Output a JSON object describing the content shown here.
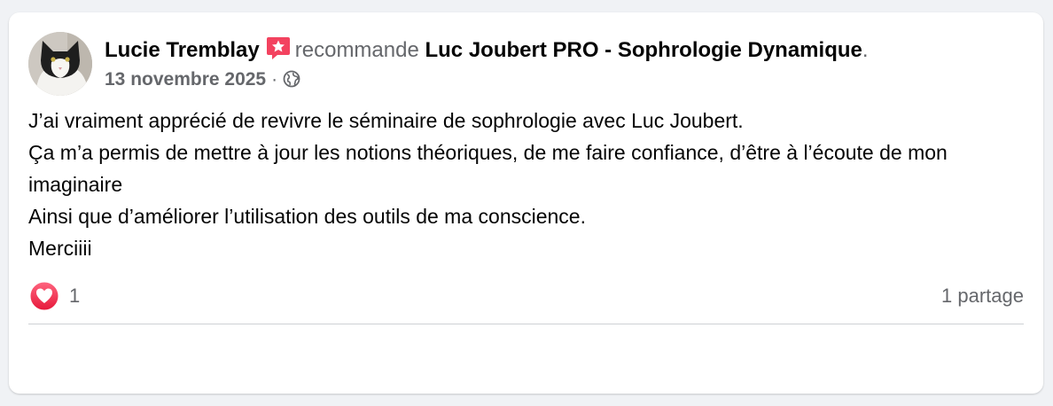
{
  "post": {
    "author": "Lucie Tremblay",
    "action": "recommande",
    "page_name": "Luc Joubert PRO - Sophrologie Dynamique",
    "period": ".",
    "date": "13 novembre 2025",
    "separator": "·",
    "privacy_icon": "globe-icon",
    "recommend_icon": "recommend-star-icon",
    "body_lines": [
      "J’ai vraiment apprécié de revivre le séminaire de sophrologie avec Luc Joubert.",
      "Ça m’a permis de mettre à jour les notions théoriques, de me faire confiance, d’être à l’écoute de mon imaginaire",
      "Ainsi que d’améliorer l’utilisation des outils de ma conscience.",
      "Merciiii"
    ]
  },
  "engagement": {
    "reaction_icon": "love-reaction-icon",
    "reaction_count": "1",
    "shares": "1 partage"
  },
  "colors": {
    "background": "#f0f2f5",
    "card": "#ffffff",
    "secondary_text": "#65676b",
    "badge": "#f3425f",
    "love": "#f33e58"
  }
}
